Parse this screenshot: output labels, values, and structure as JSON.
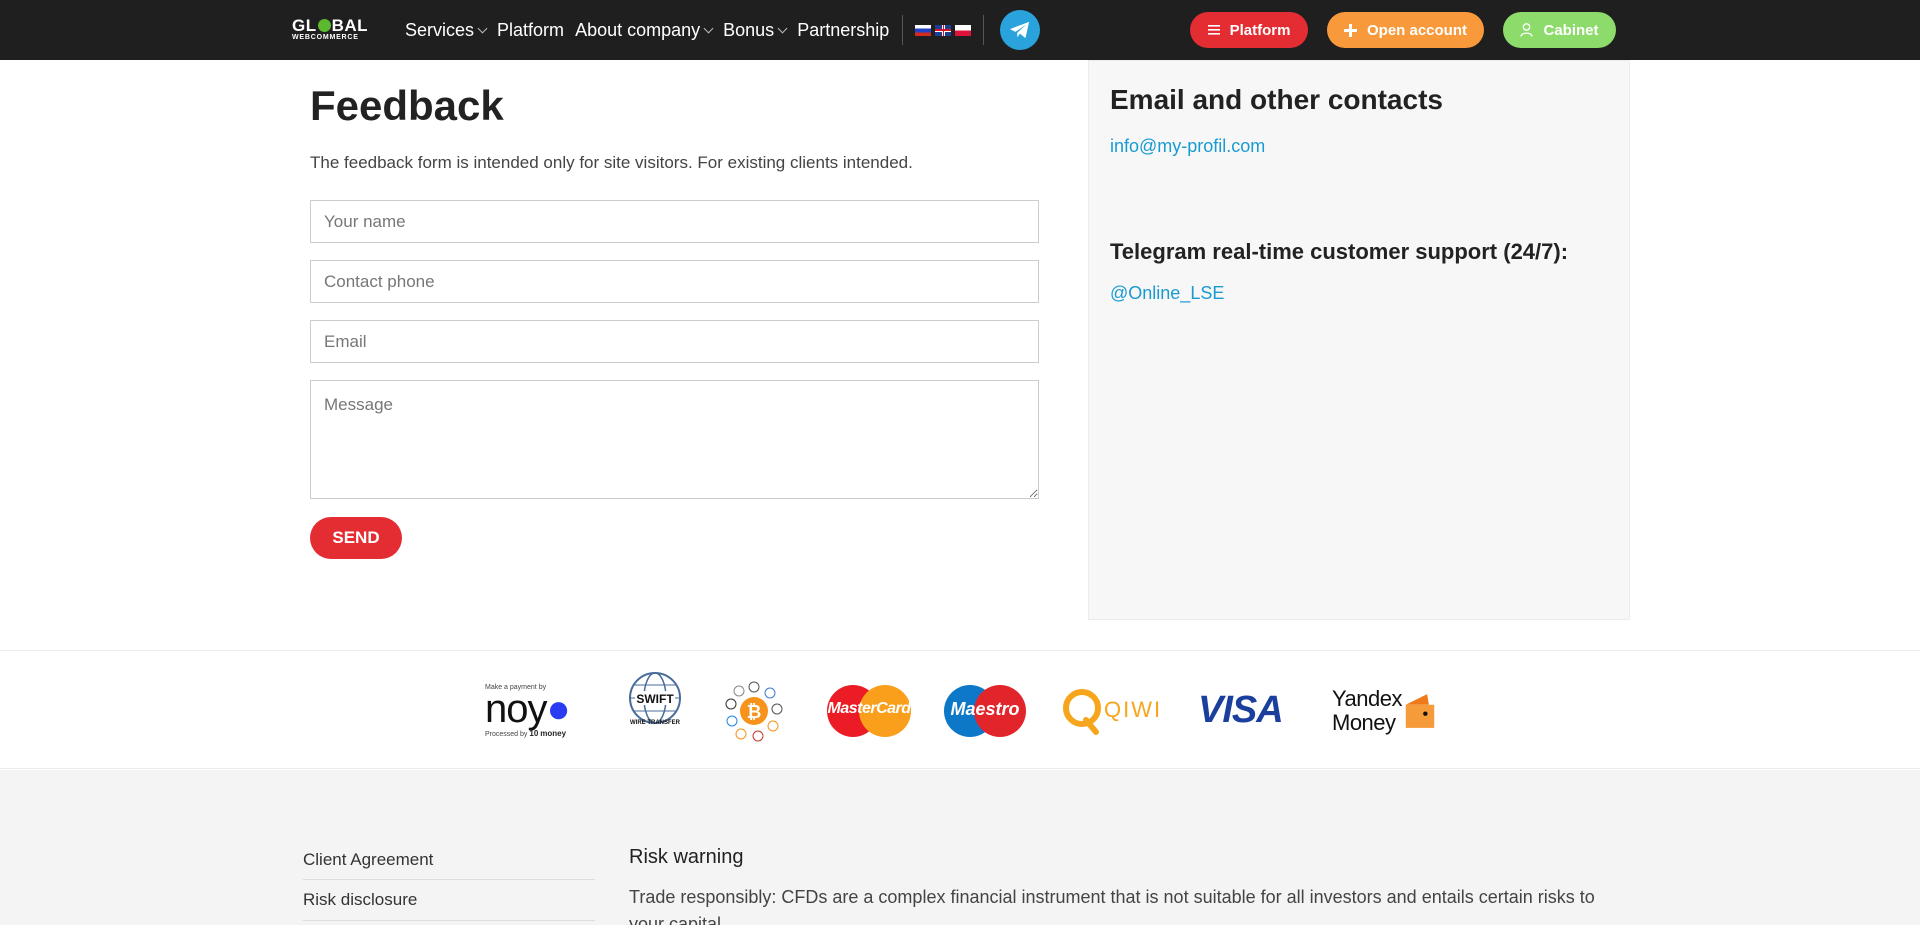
{
  "header": {
    "logo_top": "GL",
    "logo_top2": "BAL",
    "logo_sub": "WEBCOMMERCE",
    "nav": [
      {
        "label": "Services",
        "dropdown": true
      },
      {
        "label": "Platform",
        "dropdown": false
      },
      {
        "label": "About company",
        "dropdown": true
      },
      {
        "label": "Bonus",
        "dropdown": true
      },
      {
        "label": "Partnership",
        "dropdown": false
      }
    ],
    "buttons": {
      "platform": "Platform",
      "open_account": "Open account",
      "cabinet": "Cabinet"
    },
    "colors": {
      "platform": "#e32d33",
      "open_account": "#f8993b",
      "cabinet": "#8ddb6a",
      "telegram": "#2aa2dc"
    }
  },
  "feedback": {
    "title": "Feedback",
    "intro": "The feedback form is intended only for site visitors. For existing clients intended.",
    "name_placeholder": "Your name",
    "phone_placeholder": "Contact phone",
    "email_placeholder": "Email",
    "message_placeholder": "Message",
    "send_label": "SEND"
  },
  "contacts": {
    "title": "Email and other contacts",
    "email": "info@my-profil.com",
    "telegram_heading": "Telegram real-time customer support (24/7):",
    "telegram_handle": "@Online_LSE"
  },
  "payments": {
    "noy_top": "Make a payment by",
    "noy_logo": "noy",
    "noy_bottom": "Processed by",
    "noy_money": "money",
    "swift": "SWIFT",
    "swift_sub": "WIRE TRANSFER",
    "mastercard": "MasterCard",
    "maestro": "Maestro",
    "qiwi": "QIWI",
    "visa": "VISA",
    "yandex_1": "Yandex",
    "yandex_2": "Money"
  },
  "footer": {
    "links": [
      "Client Agreement",
      "Risk disclosure"
    ],
    "risk_heading": "Risk warning",
    "risk_text": "Trade responsibly: CFDs are a complex financial instrument that is not suitable for all investors and entails certain risks to your capital."
  }
}
